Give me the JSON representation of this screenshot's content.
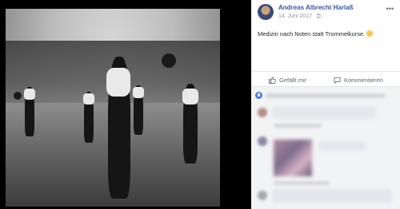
{
  "post": {
    "author": "Andreas Albrecht Harlaß",
    "date": "14. Juni 2017",
    "text": "Medizin nach Noten statt Trommelkurse.",
    "more_icon": "ellipsis-icon",
    "audience_icon": "friends-icon"
  },
  "actions": {
    "like_label": "Gefällt mir",
    "comment_label": "Kommentieren"
  },
  "colors": {
    "link": "#385898",
    "like_blue": "#4a7fdc",
    "panel_bg": "#f2f3f5"
  }
}
